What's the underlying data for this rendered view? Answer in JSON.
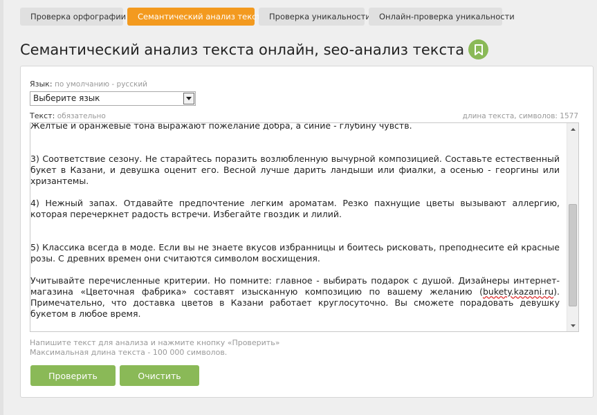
{
  "tabs": [
    {
      "label": "Проверка орфографии",
      "active": false
    },
    {
      "label": "Семантический анализ текста",
      "active": true
    },
    {
      "label": "Проверка уникальности",
      "active": false
    },
    {
      "label": "Онлайн-проверка уникальности",
      "active": false
    }
  ],
  "page": {
    "title": "Семантический анализ текста онлайн, seo-анализ текста",
    "bookmark_icon": "bookmark-icon"
  },
  "form": {
    "lang_label": "Язык:",
    "lang_hint": "по умолчанию - русский",
    "lang_select_value": "Выберите язык",
    "text_label": "Текст:",
    "text_hint": "обязательно",
    "length_label": "длина текста, символов: 1577",
    "text_lines": [
      "Желтые и оранжевые тона выражают пожелание добра, а синие - глубину чувств.",
      "3)     Соответствие сезону. Не старайтесь поразить возлюбленную вычурной композицией. Составьте естественный  букет в Казани, и девушка оценит его. Весной лучше дарить ландыши или фиалки, а осенью - георгины или хризантемы.",
      "4)     Нежный запах. Отдавайте предпочтение легким ароматам. Резко пахнущие цветы вызывают аллергию, которая перечеркнет радость встречи. Избегайте гвоздик и лилий.",
      "5)     Классика всегда в моде. Если вы не знаете вкусов избранницы и боитесь рисковать, преподнесите ей красные розы. С древних времен они считаются символом восхищения.",
      "Учитывайте перечисленные критерии. Но помните: главное - выбирать подарок с душой. Дизайнеры интернет-магазина «Цветочная фабрика» составят изысканную композицию по вашему желанию (",
      "bukety.kazani.ru",
      "). Примечательно, что доставка цветов в Казани работает круглосуточно. Вы сможете порадовать девушку букетом в любое время."
    ],
    "help_line1": "Напишите текст для анализа и нажмите кнопку «Проверить»",
    "help_line2": "Максимальная длина текста - 100 000 символов.",
    "check_button": "Проверить",
    "clear_button": "Очистить"
  },
  "colors": {
    "accent_orange": "#f39a1f",
    "accent_green": "#8ab957"
  }
}
